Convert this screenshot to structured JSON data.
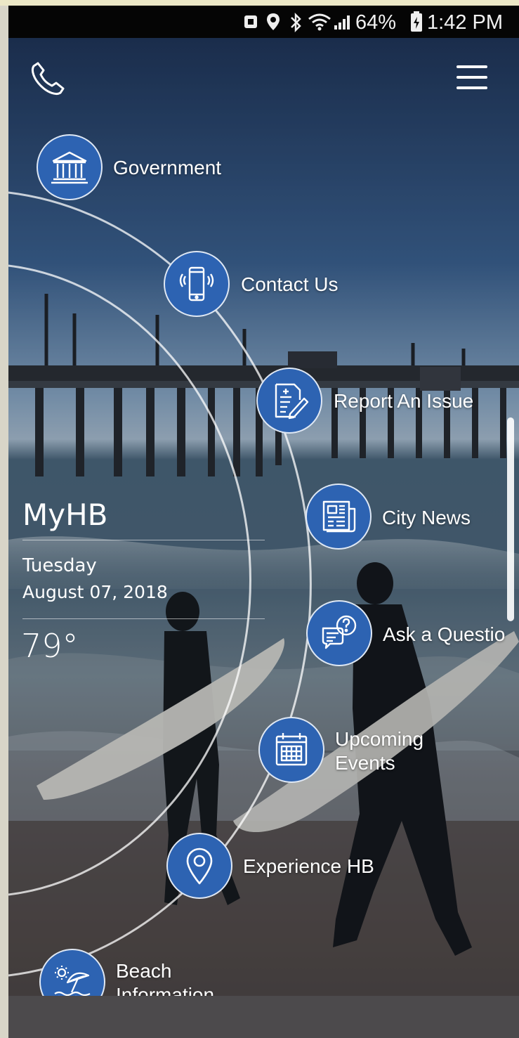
{
  "status_bar": {
    "battery_percent": "64%",
    "time": "1:42 PM",
    "icons": [
      "sim-icon",
      "location-icon",
      "bluetooth-icon",
      "wifi-icon",
      "signal-icon",
      "battery-icon"
    ]
  },
  "header": {
    "phone_icon": "phone-icon",
    "menu_icon": "hamburger-menu-icon"
  },
  "app": {
    "title": "MyHB",
    "day": "Tuesday",
    "date": "August 07, 2018",
    "temperature": "79°"
  },
  "menu_items": [
    {
      "label": "Government",
      "icon": "government-building-icon"
    },
    {
      "label": "Contact Us",
      "icon": "mobile-phone-icon"
    },
    {
      "label": "Report An Issue",
      "icon": "report-document-icon"
    },
    {
      "label": "City News",
      "icon": "newspaper-icon"
    },
    {
      "label": "Ask a Questio",
      "icon": "question-bubble-icon"
    },
    {
      "label": "Upcoming\nEvents",
      "label_line1": "Upcoming",
      "label_line2": "Events",
      "icon": "calendar-icon"
    },
    {
      "label": "Experience HB",
      "icon": "map-pin-icon"
    },
    {
      "label": "Beach\nInformation",
      "label_line1": "Beach",
      "label_line2": "Information",
      "icon": "beach-umbrella-icon"
    }
  ],
  "colors": {
    "node_blue": "#2d63b2",
    "status_bar": "#050505",
    "bottom_bar": "#4c4a4c"
  }
}
